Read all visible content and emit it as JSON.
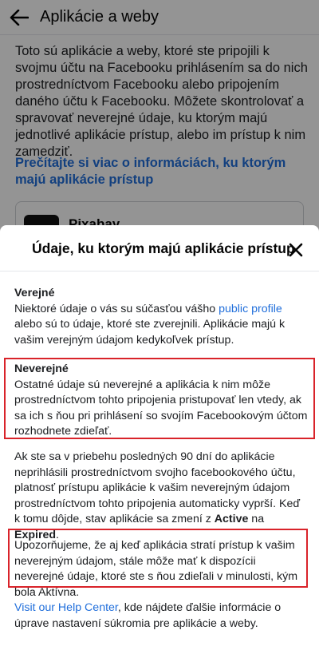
{
  "background": {
    "title": "Aplikácie a weby",
    "intro": "Toto sú aplikácie a weby, ktoré ste pripojili k svojmu účtu na Facebooku prihlásením sa do nich prostredníctvom Facebooku alebo pripojením daného účtu k Facebooku. Môžete skontrolovať a spravovať neverejné údaje, ku ktorým majú jednotlivé aplikácie prístup, alebo im prístup k nim zamedziť.",
    "learn_more_link": "Prečítajte si viac o informáciách, ku ktorým majú aplikácie prístup",
    "app_card_name": "Pixabay"
  },
  "sheet": {
    "title": "Údaje, ku ktorým majú aplikácie prístup",
    "public": {
      "heading": "Verejné",
      "text_before": "Niektoré údaje o vás su súčasťou vášho ",
      "link": "public profile",
      "text_after": " alebo sú to údaje, ktoré ste zverejnili. Aplikácie majú k vašim verejným údajom kedykoľvek prístup."
    },
    "private": {
      "heading": "Neverejné",
      "text": "Ostatné údaje sú neverejné a aplikácia k nim môže prostredníctvom tohto pripojenia pristupovať len vtedy, ak sa ich s ňou pri prihlásení so svojím Facebookovým účtom rozhodnete zdieľať."
    },
    "expiry": {
      "text_before": "Ak ste sa v priebehu posledných 90 dní do aplikácie neprihlásili prostredníctvom svojho facebookového účtu, platnosť prístupu aplikácie k vašim neverejným údajom prostredníctvom tohto pripojenia automaticky vyprší. Keď k tomu dôjde, stav aplikácie sa zmení z ",
      "status_active": "Active",
      "text_middle": " na ",
      "status_expired": "Expired",
      "text_after": "."
    },
    "warning": {
      "text": "Upozorňujeme, že aj keď aplikácia stratí prístup k vašim neverejným údajom, stále môže mať k dispozícii neverejné údaje, ktoré ste s ňou zdieľali v minulosti, kým bola Aktívna."
    },
    "help": {
      "link": "Visit our Help Center",
      "text_after": ", kde nájdete ďalšie informácie o úprave nastavení súkromia pre aplikácie a weby."
    }
  },
  "colors": {
    "link": "#216fdb",
    "highlight_border": "#d9232a",
    "overlay": "rgba(0,0,0,0.42)"
  },
  "icons": {
    "back": "arrow-left-icon",
    "close": "close-icon"
  }
}
